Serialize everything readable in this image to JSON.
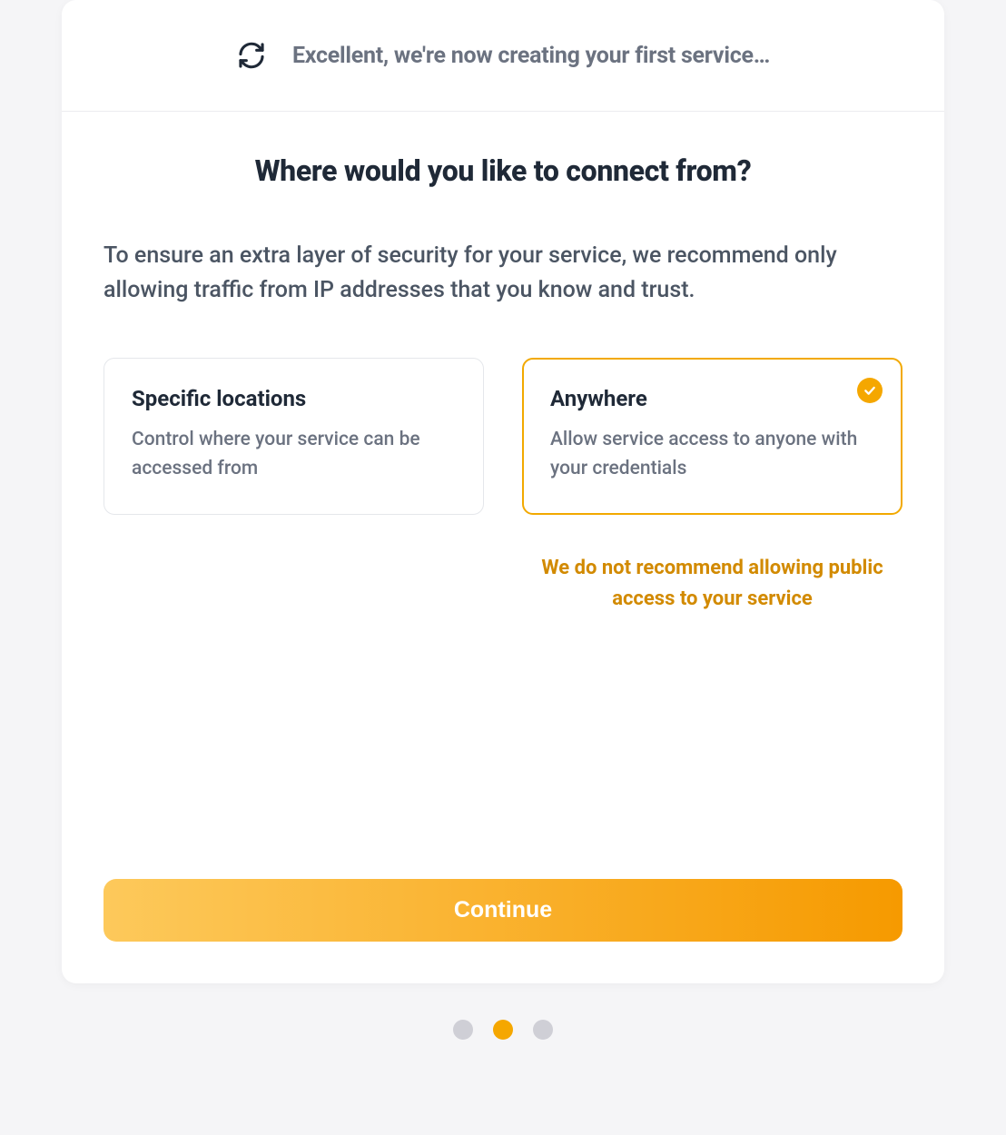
{
  "banner": {
    "text": "Excellent, we're now creating your first service…"
  },
  "page": {
    "headline": "Where would you like to connect from?",
    "subtext": "To ensure an extra layer of security for your service, we recommend only allowing traffic from IP addresses that you know and trust."
  },
  "options": [
    {
      "id": "specific-locations",
      "title": "Specific locations",
      "description": "Control where your service can be accessed from",
      "selected": false
    },
    {
      "id": "anywhere",
      "title": "Anywhere",
      "description": "Allow service access to anyone with your credentials",
      "selected": true
    }
  ],
  "warning": "We do not recommend allowing public access to your service",
  "continue_label": "Continue",
  "progress": {
    "total": 3,
    "current": 2
  },
  "colors": {
    "accent": "#f5a700",
    "muted": "#cfcfd6"
  }
}
